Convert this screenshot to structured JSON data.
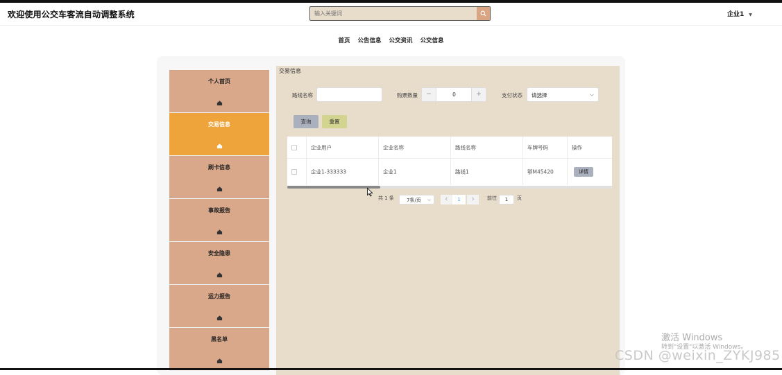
{
  "header": {
    "title": "欢迎使用公交车客流自动调整系统",
    "search_placeholder": "输入关键词",
    "user": "企业1"
  },
  "nav": [
    "首页",
    "公告信息",
    "公交资讯",
    "公交信息"
  ],
  "sidebar": {
    "items": [
      {
        "label": "个人首页",
        "active": false
      },
      {
        "label": "交易信息",
        "active": true
      },
      {
        "label": "刷卡信息",
        "active": false
      },
      {
        "label": "事故报告",
        "active": false
      },
      {
        "label": "安全隐患",
        "active": false
      },
      {
        "label": "运力报告",
        "active": false
      },
      {
        "label": "黑名单",
        "active": false
      }
    ]
  },
  "main": {
    "title": "交易信息",
    "filters": {
      "route_label": "路线名称",
      "route_value": "",
      "ticket_label": "购票数量",
      "ticket_value": "0",
      "minus": "−",
      "plus": "+",
      "pay_label": "支付状态",
      "pay_value": "请选择"
    },
    "buttons": {
      "search": "查询",
      "reset": "重置"
    },
    "table": {
      "headers": [
        "企业用户",
        "企业名称",
        "路线名称",
        "车牌号码",
        "操作"
      ],
      "rows": [
        {
          "user": "企业1-333333",
          "company": "企业1",
          "route": "路线1",
          "plate": "鄂M45420",
          "action": "详情"
        }
      ]
    },
    "pagination": {
      "total": "共 1 条",
      "page_size": "7条/页",
      "current": "1",
      "goto_label": "前往",
      "goto_value": "1",
      "page_suffix": "页"
    }
  },
  "overlay": {
    "activate_title": "激活 Windows",
    "activate_sub": "转到\"设置\"以激活 Windows。",
    "csdn": "CSDN @weixin_ZYKJ985"
  },
  "colors": {
    "sidebar": "#d9a88a",
    "sidebar_active": "#eea43a",
    "content_bg": "#e8dccb",
    "search_btn": "#d9a583",
    "query_btn": "#aab0bd",
    "reset_btn": "#d2d48f"
  }
}
